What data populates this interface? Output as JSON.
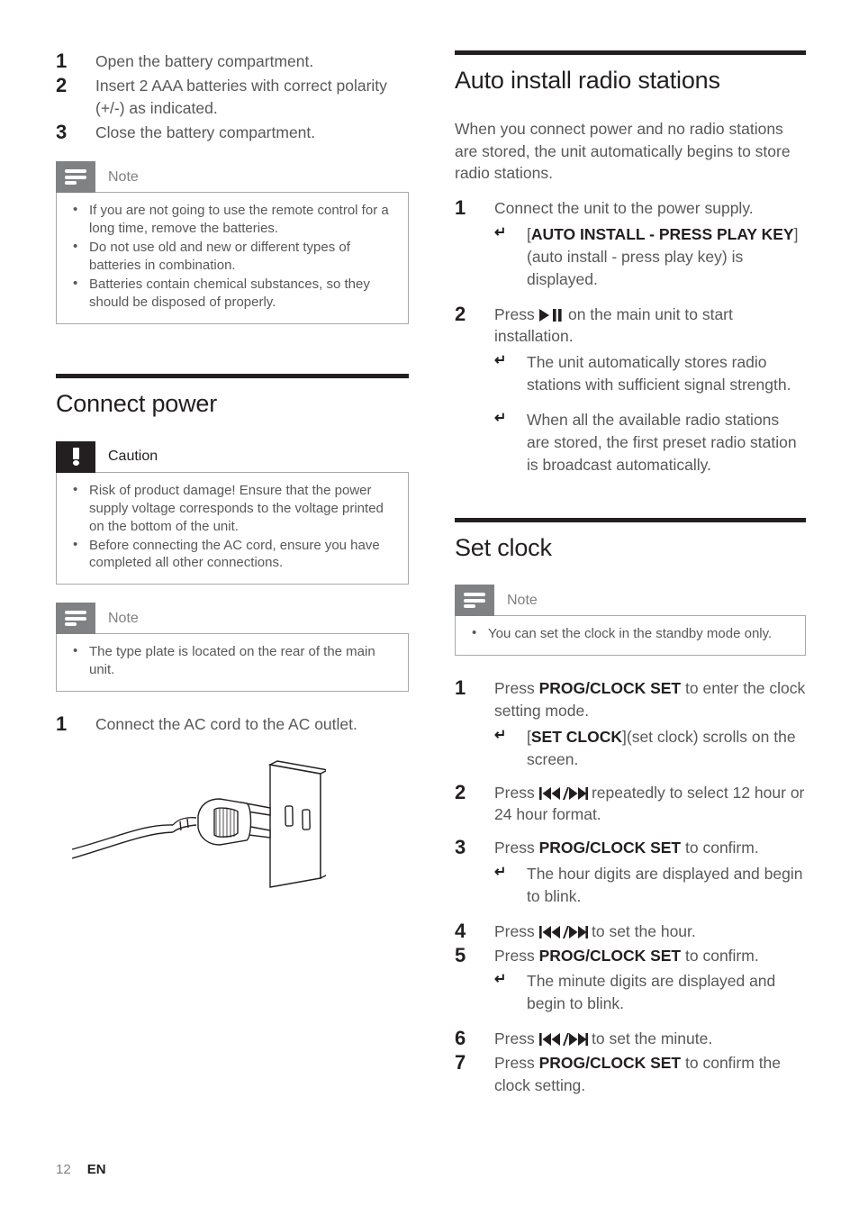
{
  "footer": {
    "page_number": "12",
    "language": "EN"
  },
  "left_column": {
    "battery_steps": [
      {
        "num": "1",
        "text": "Open the battery compartment."
      },
      {
        "num": "2",
        "text": "Insert 2 AAA batteries with correct polarity (+/-) as indicated."
      },
      {
        "num": "3",
        "text": "Close the battery compartment."
      }
    ],
    "battery_note": {
      "label": "Note",
      "icon": "note-lines-icon",
      "bullets": [
        "If you are not going to use the remote control for a long time, remove the batteries.",
        "Do not use old and new or different types of batteries in combination.",
        "Batteries contain chemical substances, so they should be disposed of properly."
      ]
    },
    "connect_power": {
      "title": "Connect power",
      "caution": {
        "label": "Caution",
        "icon": "exclamation-icon",
        "bullets": [
          "Risk of product damage! Ensure that the power supply voltage corresponds to the voltage printed on the bottom of the unit.",
          "Before connecting the AC cord, ensure you have completed all other connections."
        ]
      },
      "note": {
        "label": "Note",
        "icon": "note-lines-icon",
        "bullets": [
          "The type plate is located on the rear of the main unit."
        ]
      },
      "step": {
        "num": "1",
        "text": "Connect the AC cord to the AC outlet."
      },
      "figure_name": "ac-plug-and-wall-outlet-illustration"
    }
  },
  "right_column": {
    "auto_install": {
      "title": "Auto install radio stations",
      "intro": "When you connect power and no radio stations are stored, the unit automatically begins to store radio stations.",
      "step1": {
        "num": "1",
        "text": "Connect the unit to the power supply.",
        "result_prefix": "[",
        "result_bold": "AUTO INSTALL - PRESS PLAY KEY",
        "result_suffix": "](auto install - press play key) is displayed."
      },
      "step2": {
        "num": "2",
        "text_before": "Press",
        "glyph": "play-pause-icon",
        "text_after": "on the main unit to start installation.",
        "results": [
          "The unit automatically stores radio stations with sufficient signal strength.",
          "When all the available radio stations are stored, the first preset radio station is broadcast automatically."
        ]
      }
    },
    "set_clock": {
      "title": "Set clock",
      "note": {
        "label": "Note",
        "icon": "note-lines-icon",
        "bullets": [
          "You can set the clock in the standby mode only."
        ]
      },
      "steps": [
        {
          "num": "1",
          "text_before": "Press",
          "button": "PROG/CLOCK SET",
          "text_after": "to enter the clock setting mode.",
          "result_prefix": "[",
          "result_bold": "SET CLOCK",
          "result_suffix": "](set clock) scrolls on the screen."
        },
        {
          "num": "2",
          "text_before": "Press",
          "glyph": "skip-back-forward-icon",
          "text_after": "repeatedly to select 12 hour or 24 hour format."
        },
        {
          "num": "3",
          "text_before": "Press",
          "button": "PROG/CLOCK SET",
          "text_after": "to confirm.",
          "result": "The hour digits are displayed and begin to blink."
        },
        {
          "num": "4",
          "text_before": "Press",
          "glyph": "skip-back-forward-icon",
          "text_after": "to set the hour."
        },
        {
          "num": "5",
          "text_before": "Press",
          "button": "PROG/CLOCK SET",
          "text_after": "to confirm.",
          "result": "The minute digits are displayed and begin to blink."
        },
        {
          "num": "6",
          "text_before": "Press",
          "glyph": "skip-back-forward-icon",
          "text_after": "to set the minute."
        },
        {
          "num": "7",
          "text_before": "Press",
          "button": "PROG/CLOCK SET",
          "text_after": "to confirm the clock setting."
        }
      ]
    }
  }
}
